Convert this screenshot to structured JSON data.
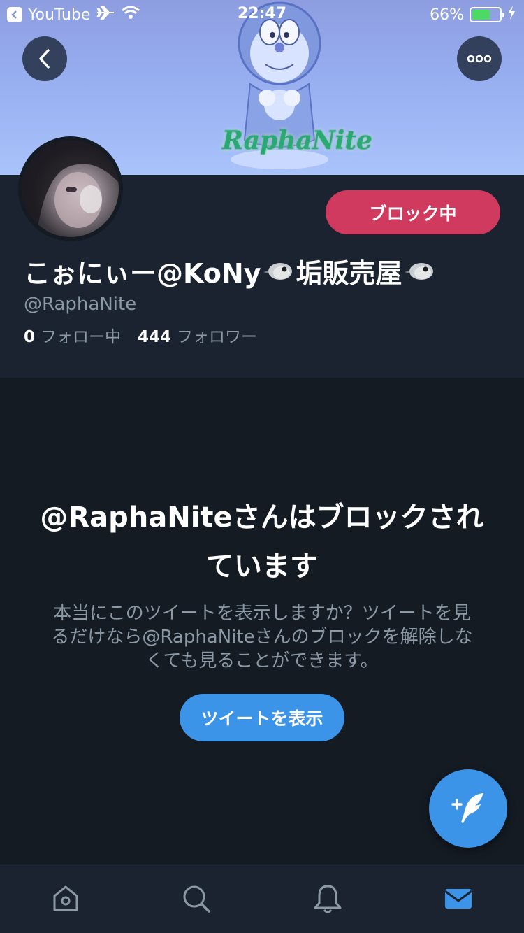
{
  "status_bar": {
    "back_app_label": "YouTube",
    "time": "22:47",
    "battery_percent": "66%",
    "battery_level": 0.66,
    "icons": [
      "back-to-app-icon",
      "airplane-icon",
      "wifi-icon",
      "battery-icon",
      "charging-icon"
    ]
  },
  "banner": {
    "watermark_text": "RaphaNite"
  },
  "nav": {
    "back_icon": "chevron-left-icon",
    "more_icon": "more-dots-icon"
  },
  "profile": {
    "display_name": "こぉにぃー@KoNy",
    "display_name_suffix": "垢販売屋",
    "handle": "@RaphaNite",
    "following_count": "0",
    "following_label": "フォロー中",
    "followers_count": "444",
    "followers_label": "フォロワー",
    "block_button_label": "ブロック中"
  },
  "blocked_notice": {
    "title": "@RaphaNiteさんはブロックされています",
    "description": "本当にこのツイートを表示しますか？ツイートを見るだけなら@RaphaNiteさんのブロックを解除しなくても見ることができます。",
    "button_label": "ツイートを表示"
  },
  "fab": {
    "icon": "compose-tweet-icon"
  },
  "tab_bar": {
    "tabs": [
      {
        "icon": "home-icon",
        "active": false
      },
      {
        "icon": "search-icon",
        "active": false
      },
      {
        "icon": "notifications-icon",
        "active": false
      },
      {
        "icon": "messages-icon",
        "active": true
      }
    ]
  },
  "colors": {
    "background": "#141b23",
    "header_background": "#1b2330",
    "accent": "#3b94e8",
    "block_red": "#d13a5f",
    "muted_text": "#8b98a5",
    "battery_green": "#4cd964"
  }
}
